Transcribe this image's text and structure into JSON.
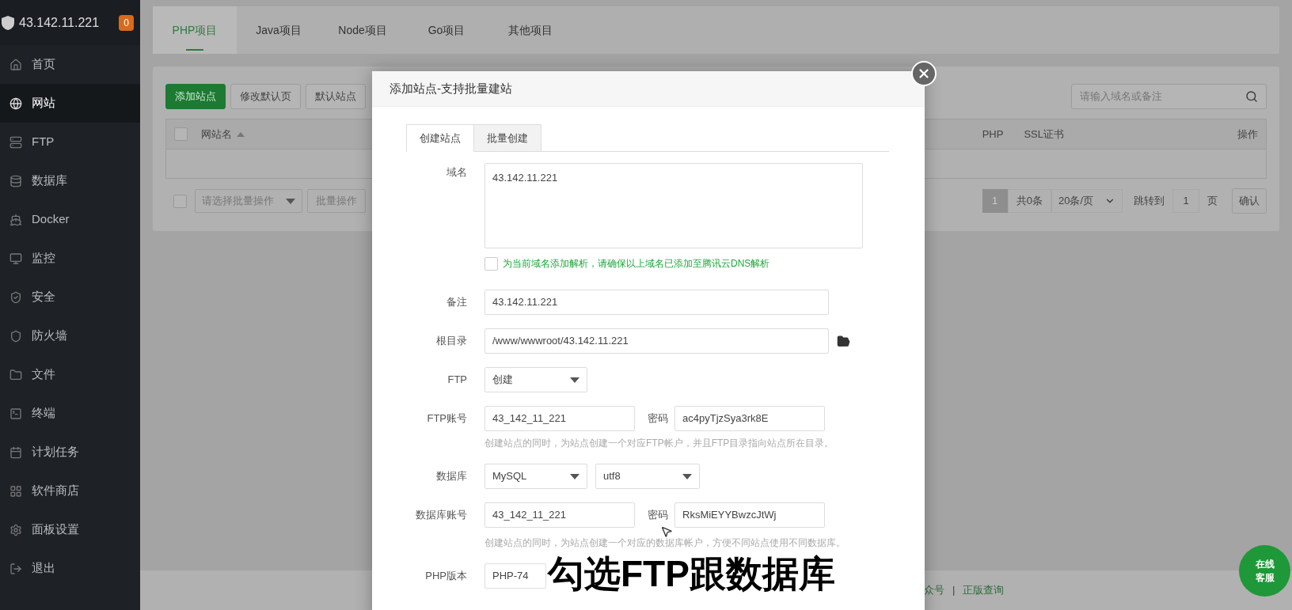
{
  "sidebar": {
    "host": "43.142.11.221",
    "badge": "0",
    "items": [
      {
        "label": "首页",
        "selected": false
      },
      {
        "label": "网站",
        "selected": true
      },
      {
        "label": "FTP",
        "selected": false
      },
      {
        "label": "数据库",
        "selected": false
      },
      {
        "label": "Docker",
        "selected": false
      },
      {
        "label": "监控",
        "selected": false
      },
      {
        "label": "安全",
        "selected": false
      },
      {
        "label": "防火墙",
        "selected": false
      },
      {
        "label": "文件",
        "selected": false
      },
      {
        "label": "终端",
        "selected": false
      },
      {
        "label": "计划任务",
        "selected": false
      },
      {
        "label": "软件商店",
        "selected": false
      },
      {
        "label": "面板设置",
        "selected": false
      },
      {
        "label": "退出",
        "selected": false
      }
    ]
  },
  "tabs": [
    {
      "label": "PHP项目",
      "selected": true
    },
    {
      "label": "Java项目",
      "selected": false
    },
    {
      "label": "Node项目",
      "selected": false
    },
    {
      "label": "Go项目",
      "selected": false
    },
    {
      "label": "其他项目",
      "selected": false
    }
  ],
  "toolbar": {
    "buttons": [
      {
        "label": "添加站点",
        "kind": "primary"
      },
      {
        "label": "修改默认页",
        "kind": "default"
      },
      {
        "label": "默认站点",
        "kind": "default"
      }
    ],
    "search": {
      "placeholder": "请输入域名或备注"
    }
  },
  "table": {
    "select_all": {
      "checked": false
    },
    "columns": [
      {
        "label": "网站名",
        "sortable": true
      },
      {
        "label": "PHP",
        "sortable": false
      },
      {
        "label": "SSL证书",
        "sortable": false
      },
      {
        "label": "操作",
        "sortable": false
      }
    ]
  },
  "batch": {
    "checked": false,
    "placeholder": "请选择批量操作",
    "button": "批量操作"
  },
  "pagination": {
    "page": "1",
    "total": "共0条",
    "per_page": "20条/页",
    "jump_label": "跳转到",
    "jump_value": "1",
    "unit": "页",
    "confirm": "确认"
  },
  "footer": {
    "links": [
      "众号",
      "正版查询"
    ],
    "separator": "|"
  },
  "chat_button": {
    "line1": "在线",
    "line2": "客服"
  },
  "modal": {
    "title": "添加站点-支持批量建站",
    "tabs": [
      {
        "label": "创建站点",
        "selected": true
      },
      {
        "label": "批量创建",
        "selected": false
      }
    ],
    "domain": {
      "label": "域名",
      "value": "43.142.11.221"
    },
    "dns": {
      "label": "为当前域名添加解析，请确保以上域名已添加至腾讯云DNS解析",
      "checked": false
    },
    "remark": {
      "label": "备注",
      "value": "43.142.11.221"
    },
    "root": {
      "label": "根目录",
      "value": "/www/wwwroot/43.142.11.221"
    },
    "ftp": {
      "label": "FTP",
      "value": "创建"
    },
    "ftp_account": {
      "label": "FTP账号",
      "value": "43_142_11_221",
      "password_label": "密码",
      "password": "ac4pyTjzSya3rk8E",
      "hint": "创建站点的同时，为站点创建一个对应FTP帐户，并且FTP目录指向站点所在目录。"
    },
    "database": {
      "label": "数据库",
      "value": "MySQL",
      "charset": "utf8"
    },
    "db_account": {
      "label": "数据库账号",
      "value": "43_142_11_221",
      "password_label": "密码",
      "password": "RksMiEYYBwzcJtWj",
      "hint": "创建站点的同时，为站点创建一个对应的数据库帐户，方便不同站点使用不同数据库。"
    },
    "php": {
      "label": "PHP版本",
      "value": "PHP-74"
    }
  },
  "caption": "勾选FTP跟数据库"
}
